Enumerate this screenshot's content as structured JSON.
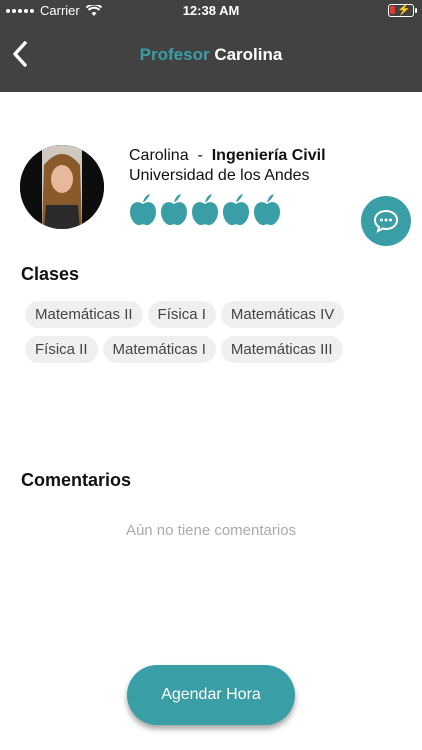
{
  "status_bar": {
    "carrier": "Carrier",
    "time": "12:38 AM"
  },
  "header": {
    "title_accent": "Profesor",
    "title_name": "Carolina"
  },
  "profile": {
    "name": "Carolina",
    "separator": " - ",
    "career": "Ingeniería Civil",
    "university": "Universidad de los Andes",
    "rating": 5,
    "rating_icon": "apple-icon",
    "accent_color": "#3a9ea6"
  },
  "classes": {
    "title": "Clases",
    "items": [
      "Matemáticas II",
      "Física I",
      "Matemáticas IV",
      "Física II",
      "Matemáticas I",
      "Matemáticas III"
    ]
  },
  "comments": {
    "title": "Comentarios",
    "empty_text": "Aún no tiene comentarios"
  },
  "cta": {
    "label": "Agendar Hora"
  }
}
